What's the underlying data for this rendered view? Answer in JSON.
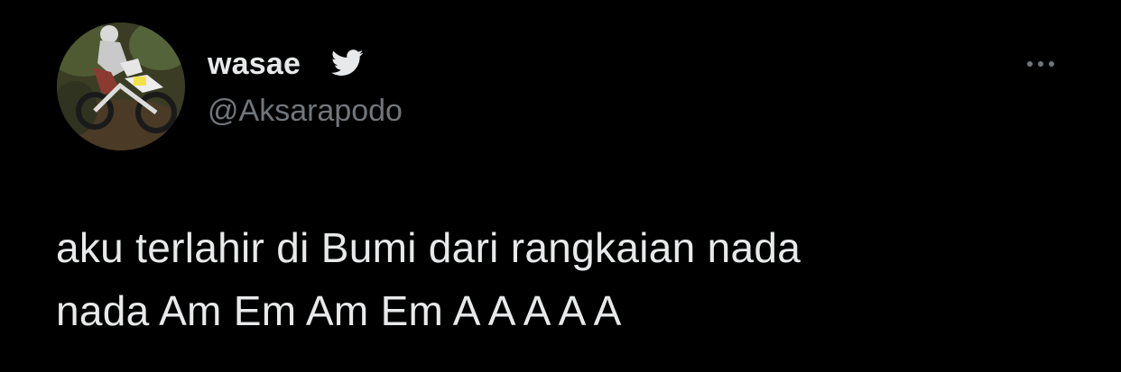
{
  "author": {
    "display_name": "wasae",
    "handle": "@Aksarapodo",
    "avatar_icon": "avatar-motocross-rider",
    "verified_icon": "twitter-bird-icon"
  },
  "tweet": {
    "line1": "aku terlahir di Bumi dari rangkaian nada",
    "line2": "nada Am Em Am Em A A A A A"
  },
  "actions": {
    "more_icon": "more-options-icon"
  },
  "colors": {
    "background": "#000000",
    "primary_text": "#e7e9ea",
    "secondary_text": "#71767b",
    "bird": "#e7e9ea"
  }
}
